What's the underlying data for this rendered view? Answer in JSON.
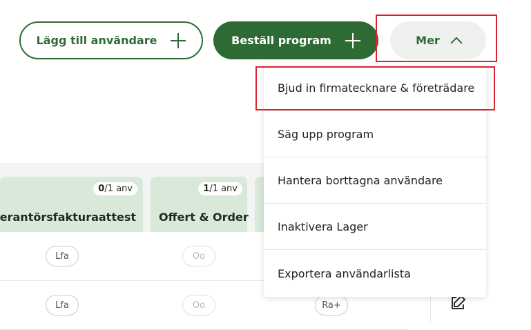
{
  "toolbar": {
    "add_user_label": "Lägg till användare",
    "order_program_label": "Beställ program",
    "more_label": "Mer"
  },
  "table": {
    "columns": [
      {
        "title": "everantörsfakturaattest",
        "count_used": "0",
        "count_total": "/1 anv"
      },
      {
        "title": "Offert & Order",
        "count_used": "1",
        "count_total": "/1 anv"
      }
    ],
    "rows": [
      {
        "cells": [
          "Lfa",
          "Oo",
          ""
        ]
      },
      {
        "cells": [
          "Lfa",
          "Oo",
          "Ra+"
        ]
      }
    ]
  },
  "dropdown": {
    "items": [
      "Bjud in firmatecknare & företrädare",
      "Säg upp program",
      "Hantera borttagna användare",
      "Inaktivera Lager",
      "Exportera användarlista"
    ]
  },
  "colors": {
    "brand_green": "#2e6b34",
    "header_green": "#d8e8d9",
    "highlight_red": "#d9232f"
  },
  "icons": [
    "plus-icon",
    "chevron-up-icon",
    "edit-icon"
  ]
}
